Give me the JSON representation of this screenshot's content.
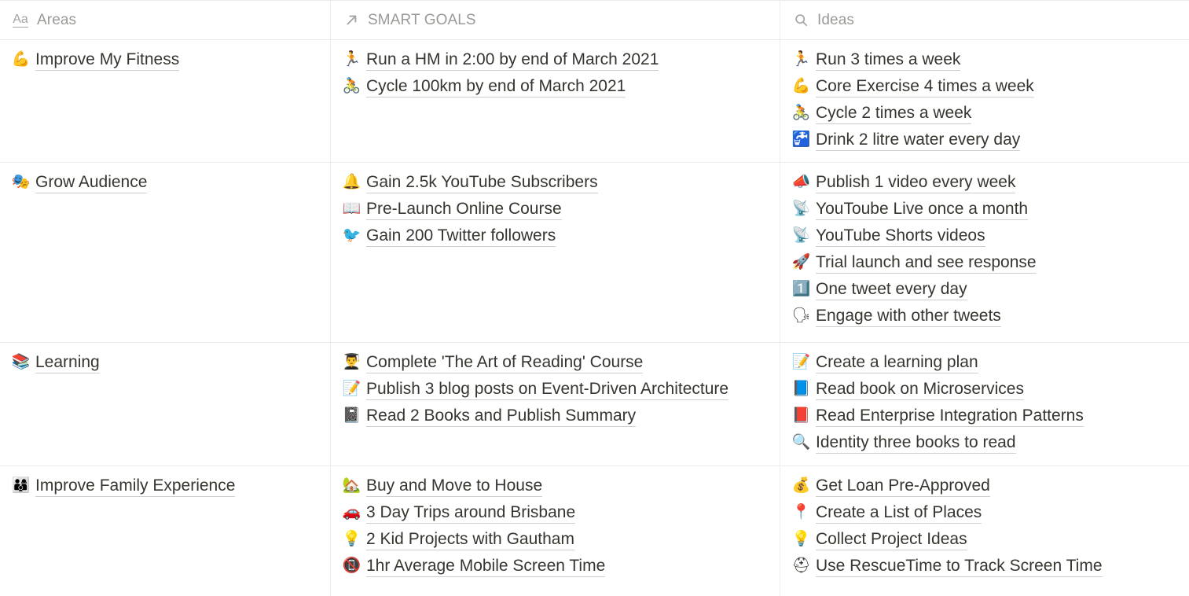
{
  "header": {
    "columns": [
      {
        "icon": "text-aa-icon",
        "label": "Areas"
      },
      {
        "icon": "relation-arrow-icon",
        "label": "SMART GOALS"
      },
      {
        "icon": "search-icon",
        "label": "Ideas"
      }
    ]
  },
  "rows": [
    {
      "area": {
        "emoji": "💪",
        "emoji_name": "flexed-biceps-emoji",
        "label": "Improve My Fitness"
      },
      "goals": [
        {
          "emoji": "🏃",
          "emoji_name": "runner-emoji",
          "label": "Run a HM in 2:00 by end of March 2021"
        },
        {
          "emoji": "🚴",
          "emoji_name": "cyclist-emoji",
          "label": "Cycle 100km by end of March 2021"
        }
      ],
      "ideas": [
        {
          "emoji": "🏃",
          "emoji_name": "runner-emoji",
          "label": "Run 3 times a week"
        },
        {
          "emoji": "💪",
          "emoji_name": "flexed-biceps-emoji",
          "label": "Core Exercise 4 times a week"
        },
        {
          "emoji": "🚴",
          "emoji_name": "cyclist-emoji",
          "label": "Cycle 2 times a week"
        },
        {
          "emoji": "🚰",
          "emoji_name": "potable-water-emoji",
          "label": "Drink 2 litre water every day"
        }
      ]
    },
    {
      "area": {
        "emoji": "🎭",
        "emoji_name": "performing-arts-emoji",
        "label": "Grow Audience"
      },
      "goals": [
        {
          "emoji": "🔔",
          "emoji_name": "bell-emoji",
          "label": "Gain 2.5k YouTube Subscribers"
        },
        {
          "emoji": "📖",
          "emoji_name": "open-book-emoji",
          "label": "Pre-Launch Online Course"
        },
        {
          "emoji": "🐦",
          "emoji_name": "bird-emoji",
          "label": "Gain 200 Twitter followers"
        }
      ],
      "ideas": [
        {
          "emoji": "📣",
          "emoji_name": "megaphone-emoji",
          "label": "Publish 1 video every week"
        },
        {
          "emoji": "📡",
          "emoji_name": "live-broadcast-emoji",
          "label": "YouToube Live once a month"
        },
        {
          "emoji": "📡",
          "emoji_name": "live-broadcast-emoji",
          "label": "YouTube Shorts videos"
        },
        {
          "emoji": "🚀",
          "emoji_name": "rocket-emoji",
          "label": "Trial launch and see response"
        },
        {
          "emoji": "1️⃣",
          "emoji_name": "keycap-one-emoji",
          "label": "One tweet every day"
        },
        {
          "emoji": "🗣",
          "emoji_name": "speaking-head-emoji",
          "label": "Engage with other tweets"
        }
      ]
    },
    {
      "area": {
        "emoji": "📚",
        "emoji_name": "books-emoji",
        "label": "Learning"
      },
      "goals": [
        {
          "emoji": "👨‍🎓",
          "emoji_name": "person-reading-emoji",
          "label": "Complete 'The Art of Reading' Course"
        },
        {
          "emoji": "📝",
          "emoji_name": "memo-emoji",
          "label": "Publish 3 blog posts on Event-Driven Architecture"
        },
        {
          "emoji": "📓",
          "emoji_name": "notebook-emoji",
          "label": "Read 2 Books and Publish Summary"
        }
      ],
      "ideas": [
        {
          "emoji": "📝",
          "emoji_name": "memo-checklist-emoji",
          "label": "Create a learning plan"
        },
        {
          "emoji": "📘",
          "emoji_name": "blue-book-emoji",
          "label": "Read book on Microservices"
        },
        {
          "emoji": "📕",
          "emoji_name": "closed-book-emoji",
          "label": "Read Enterprise Integration Patterns"
        },
        {
          "emoji": "🔍",
          "emoji_name": "magnifying-glass-emoji",
          "label": "Identity three books to read"
        }
      ]
    },
    {
      "area": {
        "emoji": "👨‍👩‍👦",
        "emoji_name": "family-emoji",
        "label": "Improve Family Experience"
      },
      "goals": [
        {
          "emoji": "🏡",
          "emoji_name": "house-with-garden-emoji",
          "label": "Buy and Move to House"
        },
        {
          "emoji": "🚗",
          "emoji_name": "car-emoji",
          "label": "3 Day Trips around Brisbane"
        },
        {
          "emoji": "💡",
          "emoji_name": "lightbulb-gear-emoji",
          "label": "2 Kid Projects with Gautham"
        },
        {
          "emoji": "📵",
          "emoji_name": "no-mobile-phones-emoji",
          "label": "1hr Average Mobile Screen Time"
        }
      ],
      "ideas": [
        {
          "emoji": "💰",
          "emoji_name": "money-person-emoji",
          "label": "Get Loan Pre-Approved"
        },
        {
          "emoji": "📍",
          "emoji_name": "map-pin-emoji",
          "label": "Create a List of Places"
        },
        {
          "emoji": "💡",
          "emoji_name": "lightbulb-emoji",
          "label": "Collect Project Ideas"
        },
        {
          "emoji": "⛑",
          "emoji_name": "rescue-cross-emoji",
          "label": "Use RescueTime to Track Screen Time"
        }
      ]
    }
  ],
  "colors": {
    "text": "#37352f",
    "muted": "#9b9a97",
    "border": "#ececeb",
    "underline": "#cfcecb"
  }
}
